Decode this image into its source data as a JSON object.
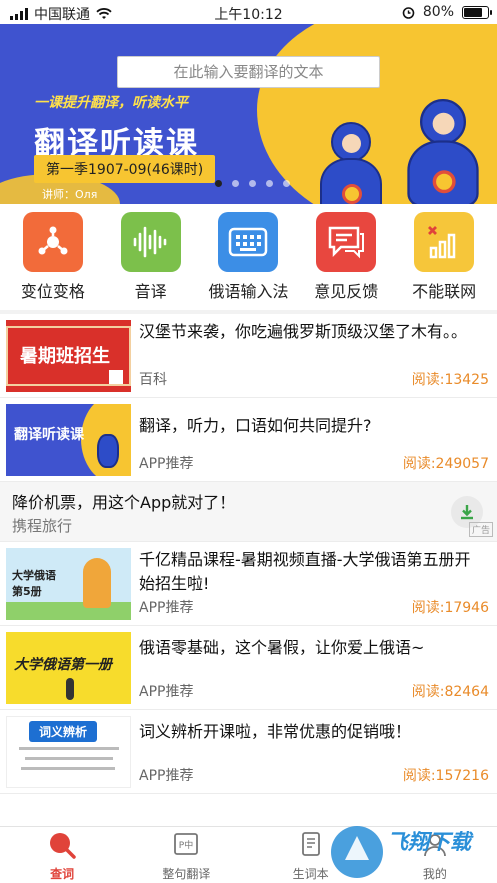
{
  "status_bar": {
    "carrier": "中国联通",
    "time": "上午10:12",
    "battery": "80%",
    "battery_level": 0.8
  },
  "banner": {
    "search_placeholder": "在此输入要翻译的文本",
    "slogan": "一课提升翻译，听读水平",
    "course_title": "翻译听读课",
    "season": "第一季1907-09(46课时)",
    "teacher": "讲师：Оля",
    "page_count": 5,
    "active_page": 0
  },
  "menu": [
    {
      "label": "变位变格",
      "color": "#f26b3a",
      "icon": "share-nodes-icon"
    },
    {
      "label": "音译",
      "color": "#7cc04b",
      "icon": "sound-wave-icon"
    },
    {
      "label": "俄语输入法",
      "color": "#3c8ee6",
      "icon": "keyboard-icon"
    },
    {
      "label": "意见反馈",
      "color": "#e8473f",
      "icon": "chat-icon"
    },
    {
      "label": "不能联网",
      "color": "#f6c63a",
      "icon": "no-signal-icon"
    }
  ],
  "feed": {
    "items": [
      {
        "title": "汉堡节来袭，你吃遍俄罗斯顶级汉堡了木有。。",
        "source": "百科",
        "reads": "阅读:13425",
        "thumb_text": "暑期班招生"
      },
      {
        "title": "翻译，听力，口语如何共同提升?",
        "source": "APP推荐",
        "reads": "阅读:249057",
        "thumb_text": "翻译听读课"
      }
    ],
    "ad": {
      "title": "降价机票，用这个App就对了！",
      "subtitle": "携程旅行",
      "tag": "广告"
    },
    "items2": [
      {
        "title": "千亿精品课程-暑期视频直播-大学俄语第五册开始招生啦!",
        "source": "APP推荐",
        "reads": "阅读:17946",
        "thumb_text": "大学俄语 第5册"
      },
      {
        "title": "俄语零基础，这个暑假，让你爱上俄语~",
        "source": "APP推荐",
        "reads": "阅读:82464",
        "thumb_text": "大学俄语第一册"
      },
      {
        "title": "词义辨析开课啦，非常优惠的促销哦！",
        "source": "APP推荐",
        "reads": "阅读:157216",
        "thumb_text": "词义辨析"
      }
    ]
  },
  "tabbar": [
    {
      "label": "查词",
      "icon": "search-icon",
      "active": true
    },
    {
      "label": "整句翻译",
      "icon": "translate-icon",
      "active": false
    },
    {
      "label": "生词本",
      "icon": "notebook-icon",
      "active": false
    },
    {
      "label": "我的",
      "icon": "profile-icon",
      "active": false
    }
  ],
  "watermark": "飞翔下载 WWW.FXXZ.COM",
  "colors": {
    "accent": "#e0433a",
    "reads": "#e98b2a",
    "banner_blue": "#3f53cf",
    "banner_yellow": "#f7c531"
  }
}
